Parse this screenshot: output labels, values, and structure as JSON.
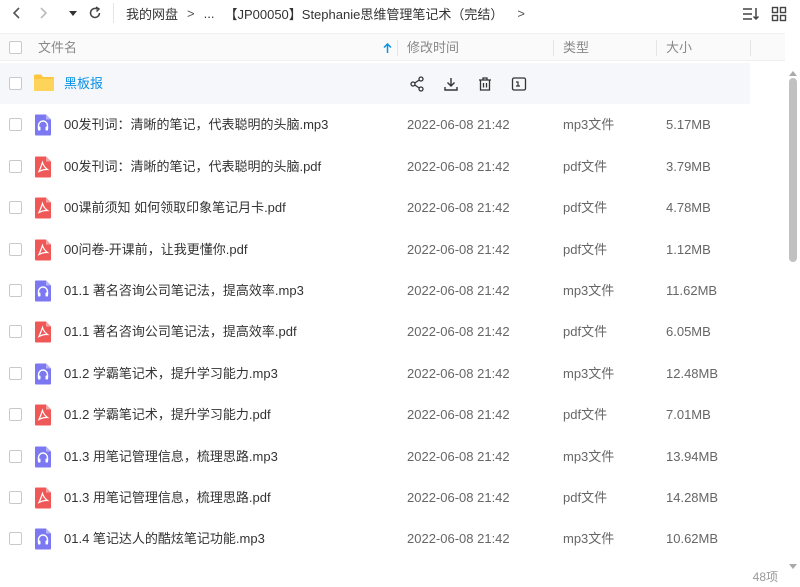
{
  "breadcrumb": {
    "root": "我的网盘",
    "sep1": ">",
    "ellipsis": "...",
    "current": "【JP00050】Stephanie思维管理笔记术（完结）",
    "sep3": ">"
  },
  "header": {
    "name": "文件名",
    "modified": "修改时间",
    "type": "类型",
    "size": "大小"
  },
  "folder": {
    "name": "黑板报"
  },
  "files": [
    {
      "name": "00发刊词：清晰的笔记，代表聪明的头脑.mp3",
      "date": "2022-06-08 21:42",
      "type": "mp3文件",
      "size": "5.17MB",
      "kind": "audio"
    },
    {
      "name": "00发刊词：清晰的笔记，代表聪明的头脑.pdf",
      "date": "2022-06-08 21:42",
      "type": "pdf文件",
      "size": "3.79MB",
      "kind": "pdf"
    },
    {
      "name": "00课前须知  如何领取印象笔记月卡.pdf",
      "date": "2022-06-08 21:42",
      "type": "pdf文件",
      "size": "4.78MB",
      "kind": "pdf"
    },
    {
      "name": "00问卷-开课前，让我更懂你.pdf",
      "date": "2022-06-08 21:42",
      "type": "pdf文件",
      "size": "1.12MB",
      "kind": "pdf"
    },
    {
      "name": "01.1 著名咨询公司笔记法，提高效率.mp3",
      "date": "2022-06-08 21:42",
      "type": "mp3文件",
      "size": "11.62MB",
      "kind": "audio"
    },
    {
      "name": "01.1 著名咨询公司笔记法，提高效率.pdf",
      "date": "2022-06-08 21:42",
      "type": "pdf文件",
      "size": "6.05MB",
      "kind": "pdf"
    },
    {
      "name": "01.2 学霸笔记术，提升学习能力.mp3",
      "date": "2022-06-08 21:42",
      "type": "mp3文件",
      "size": "12.48MB",
      "kind": "audio"
    },
    {
      "name": "01.2 学霸笔记术，提升学习能力.pdf",
      "date": "2022-06-08 21:42",
      "type": "pdf文件",
      "size": "7.01MB",
      "kind": "pdf"
    },
    {
      "name": "01.3 用笔记管理信息，梳理思路.mp3",
      "date": "2022-06-08 21:42",
      "type": "mp3文件",
      "size": "13.94MB",
      "kind": "audio"
    },
    {
      "name": "01.3 用笔记管理信息，梳理思路.pdf",
      "date": "2022-06-08 21:42",
      "type": "pdf文件",
      "size": "14.28MB",
      "kind": "pdf"
    },
    {
      "name": "01.4 笔记达人的酷炫笔记功能.mp3",
      "date": "2022-06-08 21:42",
      "type": "mp3文件",
      "size": "10.62MB",
      "kind": "audio"
    }
  ],
  "footer": {
    "count": "48项"
  },
  "colors": {
    "accent": "#0a91e6",
    "pdf": "#f05858",
    "audio": "#7b78f2",
    "folder": "#fdc63f"
  }
}
